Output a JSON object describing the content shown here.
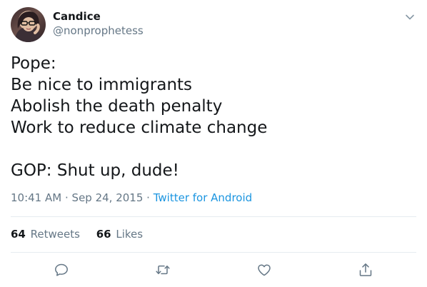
{
  "user": {
    "display_name": "Candice",
    "handle": "@nonprophetess"
  },
  "tweet": {
    "lines": [
      "Pope:",
      "Be nice to immigrants",
      "Abolish the death penalty",
      "Work to reduce climate change",
      "",
      "GOP: Shut up, dude!"
    ],
    "time": "10:41 AM",
    "separator": "·",
    "date": "Sep 24, 2015",
    "source": "Twitter for Android"
  },
  "stats": {
    "retweets_count": "64",
    "retweets_label": "Retweets",
    "likes_count": "66",
    "likes_label": "Likes"
  },
  "icons": {
    "caret": "chevron-down-icon",
    "reply": "reply-icon",
    "retweet": "retweet-icon",
    "like": "heart-icon",
    "share": "share-icon"
  },
  "colors": {
    "text": "#14171a",
    "secondary": "#657786",
    "link": "#1b95e0",
    "divider": "#e6ecf0"
  }
}
